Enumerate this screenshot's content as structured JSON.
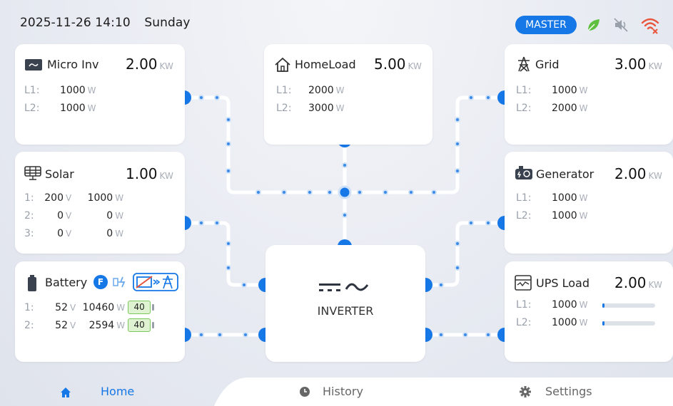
{
  "status": {
    "date": "2025-11-26 14:10",
    "weekday": "Sunday",
    "master_label": "MASTER"
  },
  "cards": {
    "micro_inv": {
      "title": "Micro Inv",
      "value": "2.00",
      "unit": "KW",
      "rows": [
        {
          "label": "L1:",
          "value": "1000",
          "unit": "W"
        },
        {
          "label": "L2:",
          "value": "1000",
          "unit": "W"
        }
      ]
    },
    "homeload": {
      "title": "HomeLoad",
      "value": "5.00",
      "unit": "KW",
      "rows": [
        {
          "label": "L1:",
          "value": "2000",
          "unit": "W"
        },
        {
          "label": "L2:",
          "value": "3000",
          "unit": "W"
        }
      ]
    },
    "grid": {
      "title": "Grid",
      "value": "3.00",
      "unit": "KW",
      "rows": [
        {
          "label": "L1:",
          "value": "1000",
          "unit": "W"
        },
        {
          "label": "L2:",
          "value": "2000",
          "unit": "W"
        }
      ]
    },
    "solar": {
      "title": "Solar",
      "value": "1.00",
      "unit": "KW",
      "rows": [
        {
          "label": "1:",
          "v": "200",
          "v_unit": "V",
          "w": "1000",
          "w_unit": "W"
        },
        {
          "label": "2:",
          "v": "0",
          "v_unit": "V",
          "w": "0",
          "w_unit": "W"
        },
        {
          "label": "3:",
          "v": "0",
          "v_unit": "V",
          "w": "0",
          "w_unit": "W"
        }
      ]
    },
    "generator": {
      "title": "Generator",
      "value": "2.00",
      "unit": "KW",
      "rows": [
        {
          "label": "L1:",
          "value": "1000",
          "unit": "W"
        },
        {
          "label": "L2:",
          "value": "1000",
          "unit": "W"
        }
      ]
    },
    "battery": {
      "title": "Battery",
      "badge": "F",
      "rows": [
        {
          "label": "1:",
          "v": "52",
          "v_unit": "V",
          "w": "10460",
          "w_unit": "W",
          "soc": "40"
        },
        {
          "label": "2:",
          "v": "52",
          "v_unit": "V",
          "w": "2594",
          "w_unit": "W",
          "soc": "40"
        }
      ]
    },
    "ups_load": {
      "title": "UPS Load",
      "value": "2.00",
      "unit": "KW",
      "rows": [
        {
          "label": "L1:",
          "value": "1000",
          "unit": "W",
          "level": 0.02
        },
        {
          "label": "L2:",
          "value": "1000",
          "unit": "W",
          "level": 0.02
        }
      ]
    }
  },
  "inverter": {
    "label": "INVERTER"
  },
  "nav": {
    "home": "Home",
    "history": "History",
    "settings": "Settings"
  },
  "colors": {
    "accent": "#1677e6",
    "flow_line": "#ffffff",
    "flow_dot": "#3a8be8",
    "active_nav": "#1677e6",
    "inactive_nav": "#666666"
  }
}
